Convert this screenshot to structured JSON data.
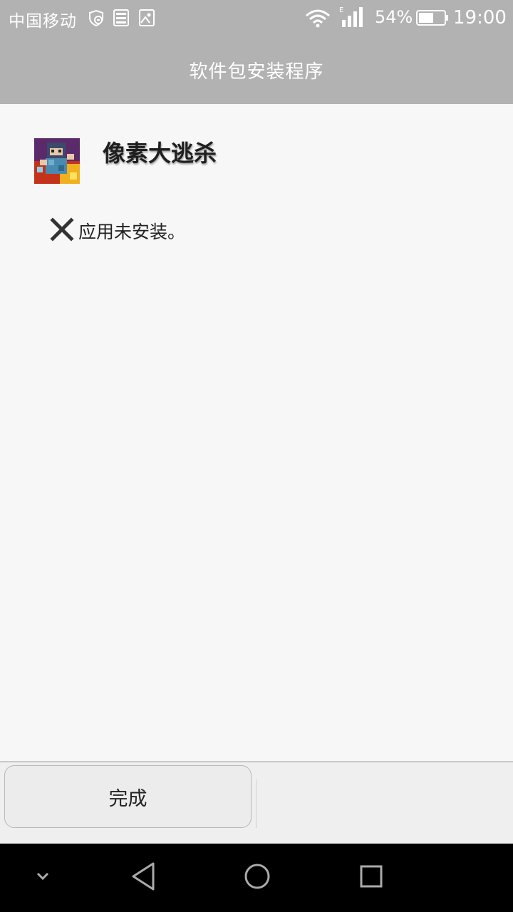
{
  "status_bar": {
    "carrier": "中国移动",
    "network_type": "E",
    "battery_percent": "54%",
    "time": "19:00"
  },
  "title_bar": {
    "title": "软件包安装程序"
  },
  "app": {
    "name": "像素大逃杀",
    "status": "应用未安装。"
  },
  "buttons": {
    "done": "完成"
  },
  "nav": {
    "items": [
      "collapse",
      "back",
      "home",
      "recents"
    ]
  }
}
